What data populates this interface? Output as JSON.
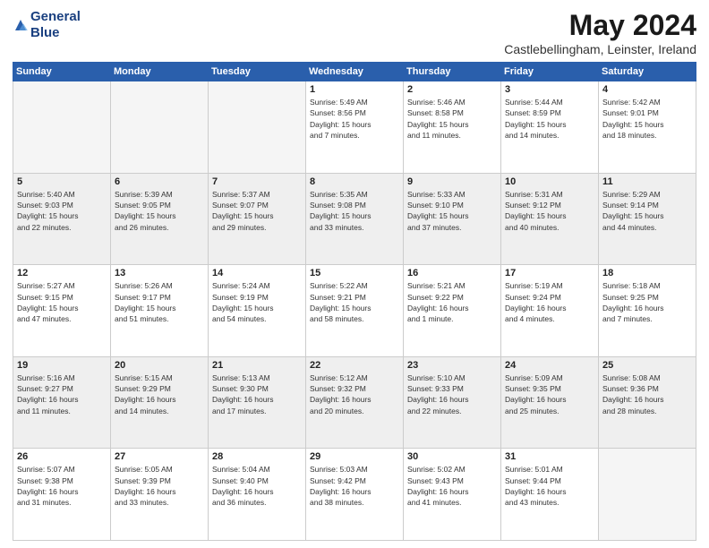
{
  "header": {
    "logo_line1": "General",
    "logo_line2": "Blue",
    "month_title": "May 2024",
    "subtitle": "Castlebellingham, Leinster, Ireland"
  },
  "days_of_week": [
    "Sunday",
    "Monday",
    "Tuesday",
    "Wednesday",
    "Thursday",
    "Friday",
    "Saturday"
  ],
  "weeks": [
    [
      {
        "day": "",
        "info": ""
      },
      {
        "day": "",
        "info": ""
      },
      {
        "day": "",
        "info": ""
      },
      {
        "day": "1",
        "info": "Sunrise: 5:49 AM\nSunset: 8:56 PM\nDaylight: 15 hours\nand 7 minutes."
      },
      {
        "day": "2",
        "info": "Sunrise: 5:46 AM\nSunset: 8:58 PM\nDaylight: 15 hours\nand 11 minutes."
      },
      {
        "day": "3",
        "info": "Sunrise: 5:44 AM\nSunset: 8:59 PM\nDaylight: 15 hours\nand 14 minutes."
      },
      {
        "day": "4",
        "info": "Sunrise: 5:42 AM\nSunset: 9:01 PM\nDaylight: 15 hours\nand 18 minutes."
      }
    ],
    [
      {
        "day": "5",
        "info": "Sunrise: 5:40 AM\nSunset: 9:03 PM\nDaylight: 15 hours\nand 22 minutes."
      },
      {
        "day": "6",
        "info": "Sunrise: 5:39 AM\nSunset: 9:05 PM\nDaylight: 15 hours\nand 26 minutes."
      },
      {
        "day": "7",
        "info": "Sunrise: 5:37 AM\nSunset: 9:07 PM\nDaylight: 15 hours\nand 29 minutes."
      },
      {
        "day": "8",
        "info": "Sunrise: 5:35 AM\nSunset: 9:08 PM\nDaylight: 15 hours\nand 33 minutes."
      },
      {
        "day": "9",
        "info": "Sunrise: 5:33 AM\nSunset: 9:10 PM\nDaylight: 15 hours\nand 37 minutes."
      },
      {
        "day": "10",
        "info": "Sunrise: 5:31 AM\nSunset: 9:12 PM\nDaylight: 15 hours\nand 40 minutes."
      },
      {
        "day": "11",
        "info": "Sunrise: 5:29 AM\nSunset: 9:14 PM\nDaylight: 15 hours\nand 44 minutes."
      }
    ],
    [
      {
        "day": "12",
        "info": "Sunrise: 5:27 AM\nSunset: 9:15 PM\nDaylight: 15 hours\nand 47 minutes."
      },
      {
        "day": "13",
        "info": "Sunrise: 5:26 AM\nSunset: 9:17 PM\nDaylight: 15 hours\nand 51 minutes."
      },
      {
        "day": "14",
        "info": "Sunrise: 5:24 AM\nSunset: 9:19 PM\nDaylight: 15 hours\nand 54 minutes."
      },
      {
        "day": "15",
        "info": "Sunrise: 5:22 AM\nSunset: 9:21 PM\nDaylight: 15 hours\nand 58 minutes."
      },
      {
        "day": "16",
        "info": "Sunrise: 5:21 AM\nSunset: 9:22 PM\nDaylight: 16 hours\nand 1 minute."
      },
      {
        "day": "17",
        "info": "Sunrise: 5:19 AM\nSunset: 9:24 PM\nDaylight: 16 hours\nand 4 minutes."
      },
      {
        "day": "18",
        "info": "Sunrise: 5:18 AM\nSunset: 9:25 PM\nDaylight: 16 hours\nand 7 minutes."
      }
    ],
    [
      {
        "day": "19",
        "info": "Sunrise: 5:16 AM\nSunset: 9:27 PM\nDaylight: 16 hours\nand 11 minutes."
      },
      {
        "day": "20",
        "info": "Sunrise: 5:15 AM\nSunset: 9:29 PM\nDaylight: 16 hours\nand 14 minutes."
      },
      {
        "day": "21",
        "info": "Sunrise: 5:13 AM\nSunset: 9:30 PM\nDaylight: 16 hours\nand 17 minutes."
      },
      {
        "day": "22",
        "info": "Sunrise: 5:12 AM\nSunset: 9:32 PM\nDaylight: 16 hours\nand 20 minutes."
      },
      {
        "day": "23",
        "info": "Sunrise: 5:10 AM\nSunset: 9:33 PM\nDaylight: 16 hours\nand 22 minutes."
      },
      {
        "day": "24",
        "info": "Sunrise: 5:09 AM\nSunset: 9:35 PM\nDaylight: 16 hours\nand 25 minutes."
      },
      {
        "day": "25",
        "info": "Sunrise: 5:08 AM\nSunset: 9:36 PM\nDaylight: 16 hours\nand 28 minutes."
      }
    ],
    [
      {
        "day": "26",
        "info": "Sunrise: 5:07 AM\nSunset: 9:38 PM\nDaylight: 16 hours\nand 31 minutes."
      },
      {
        "day": "27",
        "info": "Sunrise: 5:05 AM\nSunset: 9:39 PM\nDaylight: 16 hours\nand 33 minutes."
      },
      {
        "day": "28",
        "info": "Sunrise: 5:04 AM\nSunset: 9:40 PM\nDaylight: 16 hours\nand 36 minutes."
      },
      {
        "day": "29",
        "info": "Sunrise: 5:03 AM\nSunset: 9:42 PM\nDaylight: 16 hours\nand 38 minutes."
      },
      {
        "day": "30",
        "info": "Sunrise: 5:02 AM\nSunset: 9:43 PM\nDaylight: 16 hours\nand 41 minutes."
      },
      {
        "day": "31",
        "info": "Sunrise: 5:01 AM\nSunset: 9:44 PM\nDaylight: 16 hours\nand 43 minutes."
      },
      {
        "day": "",
        "info": ""
      }
    ]
  ]
}
